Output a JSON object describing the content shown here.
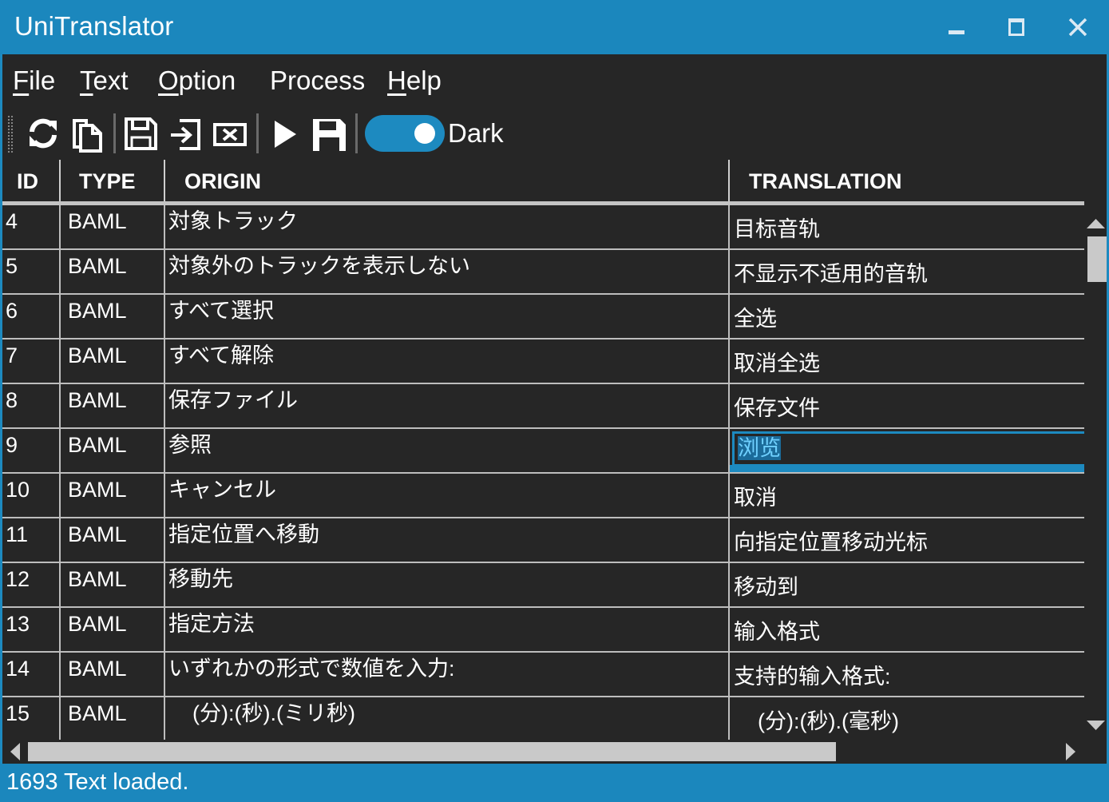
{
  "window": {
    "title": "UniTranslator",
    "controls": [
      "minimize-icon",
      "maximize-icon",
      "close-icon"
    ]
  },
  "menu": [
    {
      "mnemonic": "F",
      "rest": "ile"
    },
    {
      "mnemonic": "T",
      "rest": "ext"
    },
    {
      "mnemonic": "O",
      "rest": "ption"
    },
    {
      "mnemonic": "",
      "rest": "Process"
    },
    {
      "mnemonic": "H",
      "rest": "elp"
    }
  ],
  "toolbar": {
    "buttons": [
      "refresh-icon",
      "copy-icon",
      "save-icon",
      "import-icon",
      "clear-icon",
      "run-icon",
      "save-filled-icon"
    ],
    "theme_toggle": {
      "label": "Dark",
      "on": true
    }
  },
  "grid": {
    "columns": {
      "id": "ID",
      "type": "TYPE",
      "origin": "ORIGIN",
      "translation": "TRANSLATION"
    },
    "rows": [
      {
        "id": "4",
        "type": "BAML",
        "origin": "対象トラック",
        "translation": "目标音轨"
      },
      {
        "id": "5",
        "type": "BAML",
        "origin": "対象外のトラックを表示しない",
        "translation": "不显示不适用的音轨"
      },
      {
        "id": "6",
        "type": "BAML",
        "origin": "すべて選択",
        "translation": "全选"
      },
      {
        "id": "7",
        "type": "BAML",
        "origin": "すべて解除",
        "translation": "取消全选"
      },
      {
        "id": "8",
        "type": "BAML",
        "origin": "保存ファイル",
        "translation": "保存文件"
      },
      {
        "id": "9",
        "type": "BAML",
        "origin": "参照",
        "translation": "浏览",
        "selected": true
      },
      {
        "id": "10",
        "type": "BAML",
        "origin": "キャンセル",
        "translation": "取消"
      },
      {
        "id": "11",
        "type": "BAML",
        "origin": "指定位置へ移動",
        "translation": "向指定位置移动光标"
      },
      {
        "id": "12",
        "type": "BAML",
        "origin": "移動先",
        "translation": "移动到"
      },
      {
        "id": "13",
        "type": "BAML",
        "origin": "指定方法",
        "translation": "输入格式"
      },
      {
        "id": "14",
        "type": "BAML",
        "origin": "いずれかの形式で数値を入力:",
        "translation": "支持的输入格式:"
      },
      {
        "id": "15",
        "type": "BAML",
        "origin": "    (分):(秒).(ミリ秒)",
        "translation": "    (分):(秒).(毫秒)"
      }
    ]
  },
  "status": {
    "text": "1693 Text loaded."
  },
  "colors": {
    "accent": "#1b87bd",
    "background": "#262626",
    "text": "#ffffff",
    "scroll_thumb": "#c9c9c9"
  }
}
